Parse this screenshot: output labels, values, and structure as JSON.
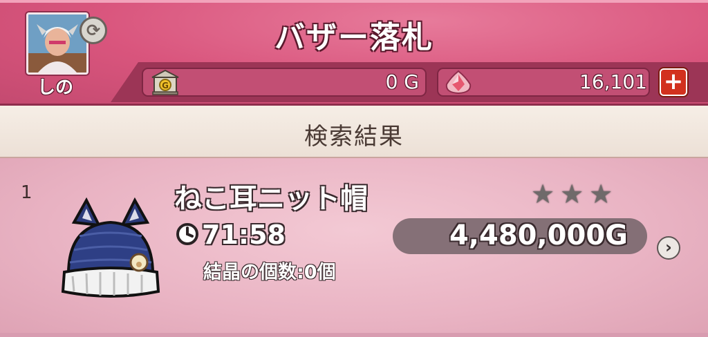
{
  "header": {
    "title": "バザー落札",
    "player_name": "しの",
    "gold_value": "0 G",
    "gem_value": "16,101",
    "plus_label": "+"
  },
  "subheader": {
    "title": "検索結果"
  },
  "results": [
    {
      "index": "1",
      "name": "ねこ耳ニット帽",
      "time_left": "71:58",
      "crystals": "結晶の個数:0個",
      "price": "4,480,000G",
      "stars": 3,
      "chevron": "›"
    }
  ],
  "icons": {
    "refresh": "refresh-icon",
    "bank": "bank-icon",
    "gem": "gem-icon",
    "clock": "clock-icon",
    "star": "star-icon"
  },
  "colors": {
    "header_pink": "#d9557d",
    "row_pink": "#e9b3c3",
    "plus_red": "#d2311e"
  }
}
